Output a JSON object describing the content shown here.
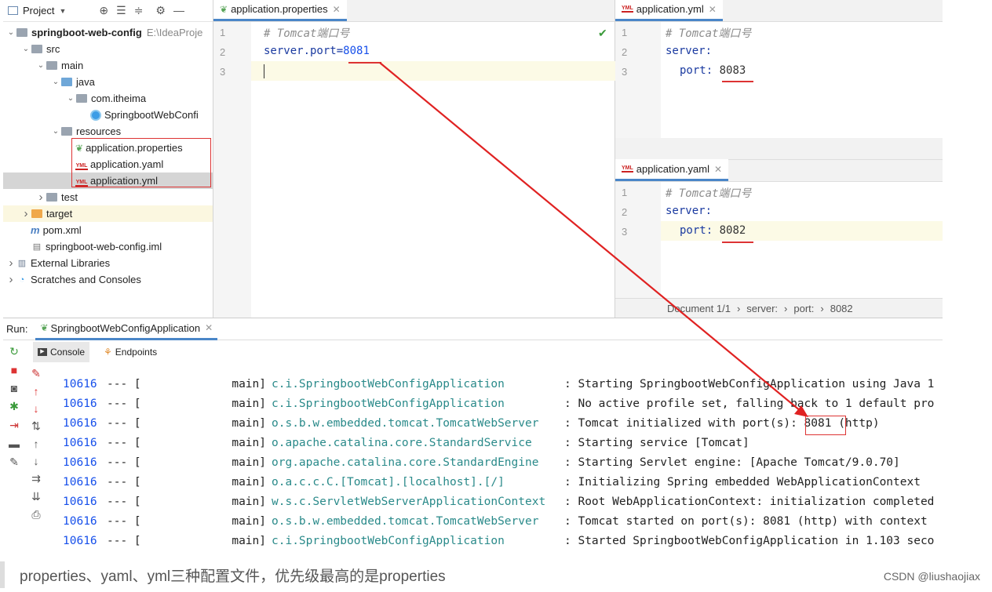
{
  "project": {
    "header": "Project",
    "tree": [
      {
        "indent": 0,
        "arrow": "v",
        "kind": "module",
        "label": "springboot-web-config",
        "extra": "E:\\IdeaProje",
        "bold": true
      },
      {
        "indent": 1,
        "arrow": "v",
        "kind": "folder",
        "label": "src"
      },
      {
        "indent": 2,
        "arrow": "v",
        "kind": "folder",
        "label": "main"
      },
      {
        "indent": 3,
        "arrow": "v",
        "kind": "folder-blue",
        "label": "java"
      },
      {
        "indent": 4,
        "arrow": "v",
        "kind": "folder",
        "label": "com.itheima"
      },
      {
        "indent": 5,
        "arrow": "",
        "kind": "class",
        "label": "SpringbootWebConfi"
      },
      {
        "indent": 3,
        "arrow": "v",
        "kind": "folder",
        "label": "resources"
      },
      {
        "indent": 4,
        "arrow": "",
        "kind": "properties",
        "label": "application.properties"
      },
      {
        "indent": 4,
        "arrow": "",
        "kind": "yml",
        "label": "application.yaml"
      },
      {
        "indent": 4,
        "arrow": "",
        "kind": "yml",
        "label": "application.yml",
        "selected": true
      },
      {
        "indent": 2,
        "arrow": ">",
        "kind": "folder",
        "label": "test"
      },
      {
        "indent": 1,
        "arrow": ">",
        "kind": "folder-orange",
        "label": "target",
        "highlight": true
      },
      {
        "indent": 1,
        "arrow": "",
        "kind": "maven",
        "label": "pom.xml"
      },
      {
        "indent": 1,
        "arrow": "",
        "kind": "iml",
        "label": "springboot-web-config.iml"
      },
      {
        "indent": 0,
        "arrow": ">",
        "kind": "libs",
        "label": "External Libraries"
      },
      {
        "indent": 0,
        "arrow": ">",
        "kind": "scratch",
        "label": "Scratches and Consoles"
      }
    ]
  },
  "editor_properties": {
    "tab": "application.properties",
    "lines": [
      "1",
      "2",
      "3"
    ],
    "comment": "# Tomcat端口号",
    "key": "server.port=",
    "value": "8081"
  },
  "editor_yml": {
    "tab": "application.yml",
    "lines": [
      "1",
      "2",
      "3"
    ],
    "comment": "# Tomcat端口号",
    "key1": "server:",
    "key2": "port:",
    "value": "8083"
  },
  "editor_yaml": {
    "tab": "application.yaml",
    "lines": [
      "1",
      "2",
      "3"
    ],
    "comment": "# Tomcat端口号",
    "key1": "server:",
    "key2": "port:",
    "value": "8082"
  },
  "breadcrumb": {
    "doc": "Document 1/1",
    "p1": "server:",
    "p2": "port:",
    "p3": "8082"
  },
  "run": {
    "label": "Run:",
    "config": "SpringbootWebConfigApplication",
    "tab_console": "Console",
    "tab_endpoints": "Endpoints",
    "logs": [
      {
        "pid": "10616",
        "dash": "--- [",
        "thread": "main]",
        "logger": "c.i.SpringbootWebConfigApplication",
        "msg": ": Starting SpringbootWebConfigApplication using Java 1"
      },
      {
        "pid": "10616",
        "dash": "--- [",
        "thread": "main]",
        "logger": "c.i.SpringbootWebConfigApplication",
        "msg": ": No active profile set, falling back to 1 default pro"
      },
      {
        "pid": "10616",
        "dash": "--- [",
        "thread": "main]",
        "logger": "o.s.b.w.embedded.tomcat.TomcatWebServer",
        "msg": ": Tomcat initialized with port(s): 8081 (http)"
      },
      {
        "pid": "10616",
        "dash": "--- [",
        "thread": "main]",
        "logger": "o.apache.catalina.core.StandardService",
        "msg": ": Starting service [Tomcat]"
      },
      {
        "pid": "10616",
        "dash": "--- [",
        "thread": "main]",
        "logger": "org.apache.catalina.core.StandardEngine",
        "msg": ": Starting Servlet engine: [Apache Tomcat/9.0.70]"
      },
      {
        "pid": "10616",
        "dash": "--- [",
        "thread": "main]",
        "logger": "o.a.c.c.C.[Tomcat].[localhost].[/]",
        "msg": ": Initializing Spring embedded WebApplicationContext"
      },
      {
        "pid": "10616",
        "dash": "--- [",
        "thread": "main]",
        "logger": "w.s.c.ServletWebServerApplicationContext",
        "msg": ": Root WebApplicationContext: initialization completed"
      },
      {
        "pid": "10616",
        "dash": "--- [",
        "thread": "main]",
        "logger": "o.s.b.w.embedded.tomcat.TomcatWebServer",
        "msg": ": Tomcat started on port(s): 8081 (http) with context"
      },
      {
        "pid": "10616",
        "dash": "--- [",
        "thread": "main]",
        "logger": "c.i.SpringbootWebConfigApplication",
        "msg": ": Started SpringbootWebConfigApplication in 1.103 seco"
      }
    ]
  },
  "caption": "properties、yaml、yml三种配置文件，优先级最高的是properties",
  "watermark": "CSDN @liushaojiax",
  "colors": {
    "accent": "#4a86c8",
    "annotation": "#dd3333"
  }
}
